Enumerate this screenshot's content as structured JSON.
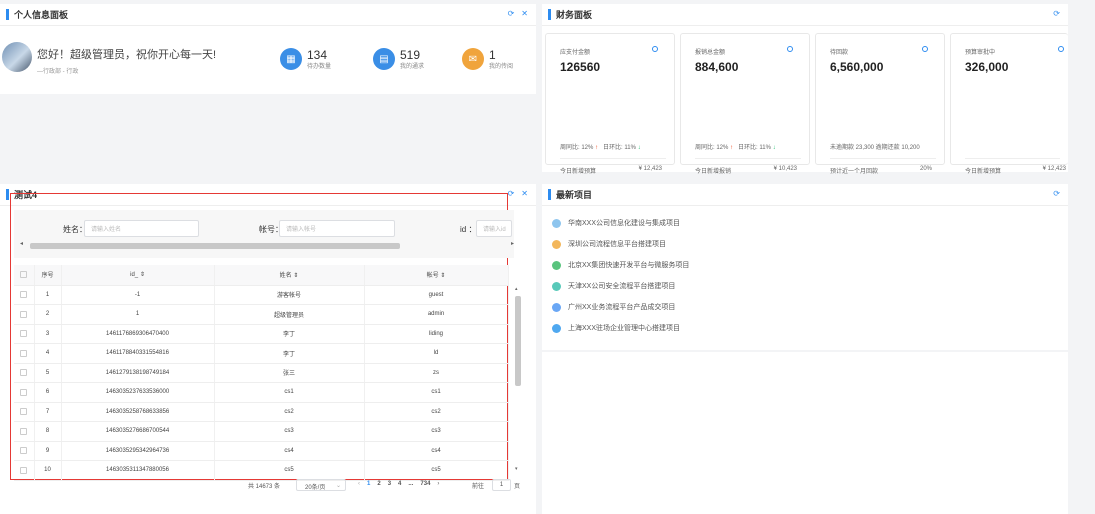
{
  "personal": {
    "title": "个人信息面板",
    "greeting": "您好！超级管理员，祝你开心每一天!",
    "subtitle": "—行政部 - 行政",
    "stats": [
      {
        "num": "134",
        "label": "待办数量",
        "color": "#3a8ee6",
        "icon": "calendar-icon"
      },
      {
        "num": "519",
        "label": "我的通求",
        "color": "#3a8ee6",
        "icon": "document-icon"
      },
      {
        "num": "1",
        "label": "我的传阅",
        "color": "#f0a43c",
        "icon": "mail-icon"
      }
    ]
  },
  "finance": {
    "title": "财务面板",
    "cards": [
      {
        "title": "应支付金额",
        "value": "126560",
        "ratio": "周同比: 12%",
        "ratio2": "日环比: 11%",
        "foot_label": "今日新增预算",
        "foot_value": "¥ 12,423"
      },
      {
        "title": "报销总金额",
        "value": "884,600",
        "ratio": "周同比: 12%",
        "ratio2": "日环比: 11%",
        "foot_label": "今日新增报销",
        "foot_value": "¥ 10,423"
      },
      {
        "title": "待回款",
        "value": "6,560,000",
        "ratio": "未逾期款 23,300 逾期还款 10,200",
        "ratio2": "",
        "foot_label": "预计近一个月回款",
        "foot_value": "20%"
      },
      {
        "title": "预算审批中",
        "value": "326,000",
        "ratio": "",
        "ratio2": "",
        "foot_label": "今日新增预算",
        "foot_value": "¥ 12,423"
      }
    ]
  },
  "test": {
    "title": "测试4",
    "filters": [
      {
        "label": "姓名：",
        "placeholder": "请输入姓名"
      },
      {
        "label": "帐号：",
        "placeholder": "请输入帐号"
      },
      {
        "label": "id ：",
        "placeholder": "请输入id"
      }
    ],
    "columns": [
      "序号",
      "id_ ⇕",
      "姓名 ⇕",
      "帐号 ⇕"
    ],
    "rows": [
      [
        "1",
        "-1",
        "游客帐号",
        "guest"
      ],
      [
        "2",
        "1",
        "超级管理员",
        "admin"
      ],
      [
        "3",
        "1461176869306470400",
        "李丁",
        "liding"
      ],
      [
        "4",
        "1461178840331554816",
        "李丁",
        "ld"
      ],
      [
        "5",
        "1461279138198749184",
        "张三",
        "zs"
      ],
      [
        "6",
        "1463035237633536000",
        "cs1",
        "cs1"
      ],
      [
        "7",
        "1463035258768633856",
        "cs2",
        "cs2"
      ],
      [
        "8",
        "1463035276686700544",
        "cs3",
        "cs3"
      ],
      [
        "9",
        "1463035295342964736",
        "cs4",
        "cs4"
      ],
      [
        "10",
        "1463035311347880056",
        "cs5",
        "cs5"
      ]
    ],
    "pager": {
      "total": "共 14673 条",
      "size": "20条/页",
      "pages": [
        "1",
        "2",
        "3",
        "4",
        "...",
        "734"
      ],
      "goto": "前往",
      "goto_value": "1",
      "page_unit": "页"
    }
  },
  "projects": {
    "title": "最新项目",
    "items": [
      {
        "label": "华南XXX公司信息化建设与集成项目",
        "color": "#8ec5ee"
      },
      {
        "label": "深圳公司流程信息平台搭建项目",
        "color": "#f3b75c"
      },
      {
        "label": "北京XX集团快速开发平台与微服务项目",
        "color": "#5ac47e"
      },
      {
        "label": "天津XX公司安全流程平台搭建项目",
        "color": "#58c9b9"
      },
      {
        "label": "广州XX业务流程平台产品成交项目",
        "color": "#6aa7f5"
      },
      {
        "label": "上海XXX驻场企业管理中心搭建项目",
        "color": "#4fa8f0"
      }
    ]
  }
}
